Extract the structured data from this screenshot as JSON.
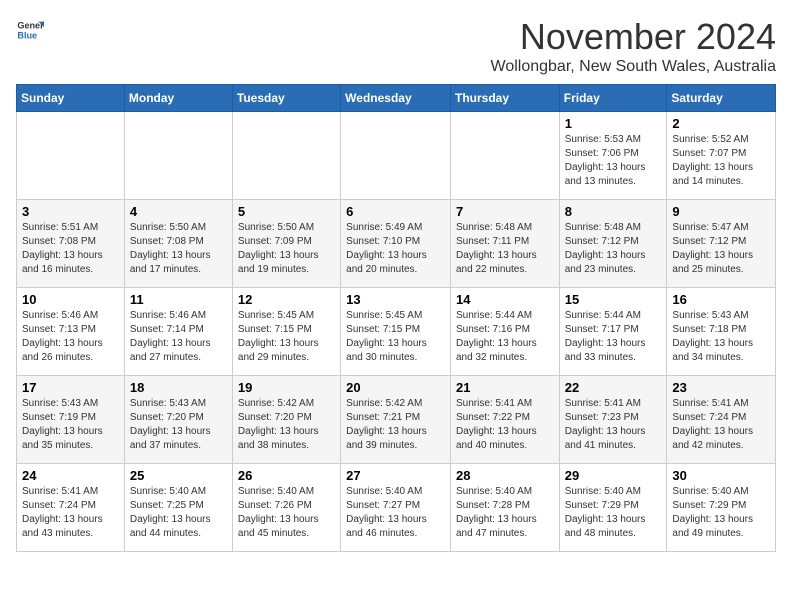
{
  "logo": {
    "line1": "General",
    "line2": "Blue"
  },
  "title": "November 2024",
  "location": "Wollongbar, New South Wales, Australia",
  "headers": [
    "Sunday",
    "Monday",
    "Tuesday",
    "Wednesday",
    "Thursday",
    "Friday",
    "Saturday"
  ],
  "weeks": [
    [
      {
        "day": "",
        "info": ""
      },
      {
        "day": "",
        "info": ""
      },
      {
        "day": "",
        "info": ""
      },
      {
        "day": "",
        "info": ""
      },
      {
        "day": "",
        "info": ""
      },
      {
        "day": "1",
        "info": "Sunrise: 5:53 AM\nSunset: 7:06 PM\nDaylight: 13 hours\nand 13 minutes."
      },
      {
        "day": "2",
        "info": "Sunrise: 5:52 AM\nSunset: 7:07 PM\nDaylight: 13 hours\nand 14 minutes."
      }
    ],
    [
      {
        "day": "3",
        "info": "Sunrise: 5:51 AM\nSunset: 7:08 PM\nDaylight: 13 hours\nand 16 minutes."
      },
      {
        "day": "4",
        "info": "Sunrise: 5:50 AM\nSunset: 7:08 PM\nDaylight: 13 hours\nand 17 minutes."
      },
      {
        "day": "5",
        "info": "Sunrise: 5:50 AM\nSunset: 7:09 PM\nDaylight: 13 hours\nand 19 minutes."
      },
      {
        "day": "6",
        "info": "Sunrise: 5:49 AM\nSunset: 7:10 PM\nDaylight: 13 hours\nand 20 minutes."
      },
      {
        "day": "7",
        "info": "Sunrise: 5:48 AM\nSunset: 7:11 PM\nDaylight: 13 hours\nand 22 minutes."
      },
      {
        "day": "8",
        "info": "Sunrise: 5:48 AM\nSunset: 7:12 PM\nDaylight: 13 hours\nand 23 minutes."
      },
      {
        "day": "9",
        "info": "Sunrise: 5:47 AM\nSunset: 7:12 PM\nDaylight: 13 hours\nand 25 minutes."
      }
    ],
    [
      {
        "day": "10",
        "info": "Sunrise: 5:46 AM\nSunset: 7:13 PM\nDaylight: 13 hours\nand 26 minutes."
      },
      {
        "day": "11",
        "info": "Sunrise: 5:46 AM\nSunset: 7:14 PM\nDaylight: 13 hours\nand 27 minutes."
      },
      {
        "day": "12",
        "info": "Sunrise: 5:45 AM\nSunset: 7:15 PM\nDaylight: 13 hours\nand 29 minutes."
      },
      {
        "day": "13",
        "info": "Sunrise: 5:45 AM\nSunset: 7:15 PM\nDaylight: 13 hours\nand 30 minutes."
      },
      {
        "day": "14",
        "info": "Sunrise: 5:44 AM\nSunset: 7:16 PM\nDaylight: 13 hours\nand 32 minutes."
      },
      {
        "day": "15",
        "info": "Sunrise: 5:44 AM\nSunset: 7:17 PM\nDaylight: 13 hours\nand 33 minutes."
      },
      {
        "day": "16",
        "info": "Sunrise: 5:43 AM\nSunset: 7:18 PM\nDaylight: 13 hours\nand 34 minutes."
      }
    ],
    [
      {
        "day": "17",
        "info": "Sunrise: 5:43 AM\nSunset: 7:19 PM\nDaylight: 13 hours\nand 35 minutes."
      },
      {
        "day": "18",
        "info": "Sunrise: 5:43 AM\nSunset: 7:20 PM\nDaylight: 13 hours\nand 37 minutes."
      },
      {
        "day": "19",
        "info": "Sunrise: 5:42 AM\nSunset: 7:20 PM\nDaylight: 13 hours\nand 38 minutes."
      },
      {
        "day": "20",
        "info": "Sunrise: 5:42 AM\nSunset: 7:21 PM\nDaylight: 13 hours\nand 39 minutes."
      },
      {
        "day": "21",
        "info": "Sunrise: 5:41 AM\nSunset: 7:22 PM\nDaylight: 13 hours\nand 40 minutes."
      },
      {
        "day": "22",
        "info": "Sunrise: 5:41 AM\nSunset: 7:23 PM\nDaylight: 13 hours\nand 41 minutes."
      },
      {
        "day": "23",
        "info": "Sunrise: 5:41 AM\nSunset: 7:24 PM\nDaylight: 13 hours\nand 42 minutes."
      }
    ],
    [
      {
        "day": "24",
        "info": "Sunrise: 5:41 AM\nSunset: 7:24 PM\nDaylight: 13 hours\nand 43 minutes."
      },
      {
        "day": "25",
        "info": "Sunrise: 5:40 AM\nSunset: 7:25 PM\nDaylight: 13 hours\nand 44 minutes."
      },
      {
        "day": "26",
        "info": "Sunrise: 5:40 AM\nSunset: 7:26 PM\nDaylight: 13 hours\nand 45 minutes."
      },
      {
        "day": "27",
        "info": "Sunrise: 5:40 AM\nSunset: 7:27 PM\nDaylight: 13 hours\nand 46 minutes."
      },
      {
        "day": "28",
        "info": "Sunrise: 5:40 AM\nSunset: 7:28 PM\nDaylight: 13 hours\nand 47 minutes."
      },
      {
        "day": "29",
        "info": "Sunrise: 5:40 AM\nSunset: 7:29 PM\nDaylight: 13 hours\nand 48 minutes."
      },
      {
        "day": "30",
        "info": "Sunrise: 5:40 AM\nSunset: 7:29 PM\nDaylight: 13 hours\nand 49 minutes."
      }
    ]
  ]
}
